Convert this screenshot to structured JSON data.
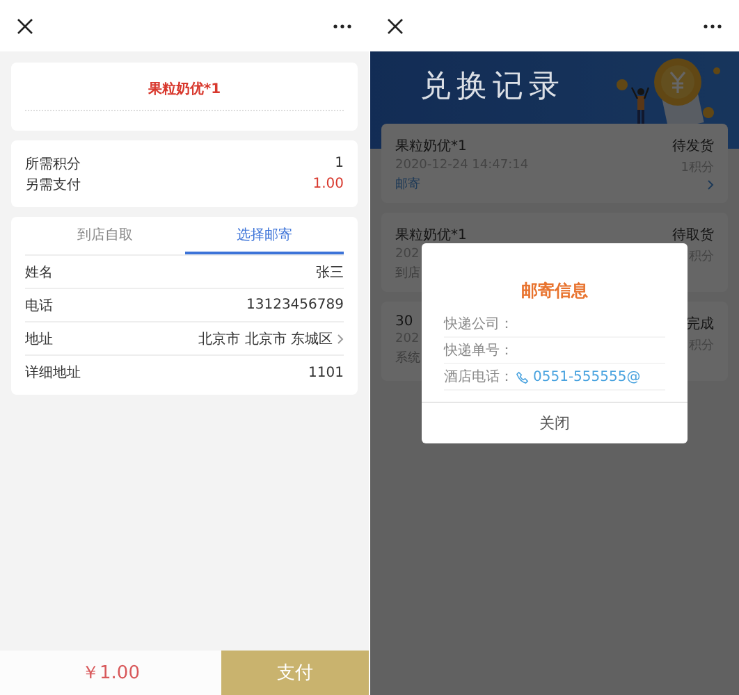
{
  "order_screen": {
    "product_title": "果粒奶优*1",
    "costs": [
      {
        "label": "所需积分",
        "value": "1",
        "kind": "plain"
      },
      {
        "label": "另需支付",
        "value": "1.00",
        "kind": "amount"
      }
    ],
    "delivery_tabs": [
      {
        "label": "到店自取",
        "selected": false
      },
      {
        "label": "选择邮寄",
        "selected": true
      }
    ],
    "address_fields": [
      {
        "label": "姓名",
        "value": "张三",
        "kind": "text"
      },
      {
        "label": "电话",
        "value": "13123456789",
        "kind": "text"
      },
      {
        "label": "地址",
        "value": "北京市 北京市 东城区",
        "kind": "select"
      },
      {
        "label": "详细地址",
        "value": "1101",
        "kind": "text"
      }
    ],
    "footer": {
      "total": "￥1.00",
      "pay_button": "支付"
    }
  },
  "records_screen": {
    "banner_title": "兑换记录",
    "records": [
      {
        "title": "果粒奶优*1",
        "date": "2020-12-24 14:47:14",
        "method": "邮寄",
        "link": true,
        "status": "待发货",
        "points": "1积分",
        "arrow": true
      },
      {
        "title": "果粒奶优*1",
        "date": "202",
        "method": "到店",
        "link": false,
        "status": "待取货",
        "points": "积分",
        "arrow": false
      },
      {
        "title": "30",
        "date": "202",
        "method": "系统",
        "link": false,
        "status": "完成",
        "points": "积分",
        "arrow": false
      }
    ],
    "dialog": {
      "title": "邮寄信息",
      "fields": [
        {
          "label": "快递公司：",
          "kind": "text"
        },
        {
          "label": "快递单号：",
          "kind": "text"
        },
        {
          "label": "酒店电话：",
          "value": "0551-555555@",
          "kind": "phone"
        }
      ],
      "close_button": "关闭"
    }
  }
}
